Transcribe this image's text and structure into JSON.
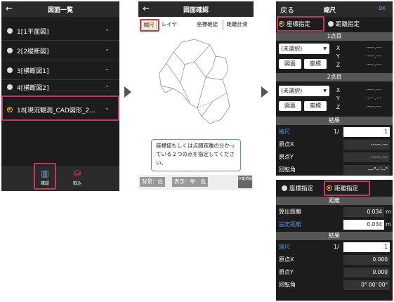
{
  "panel1": {
    "title": "図面一覧",
    "back": "←",
    "items": [
      {
        "label": "1[1平面図]"
      },
      {
        "label": "2[2縦断図]"
      },
      {
        "label": "3[横断図1]"
      },
      {
        "label": "4[横断図2]"
      },
      {
        "label": "18[現況観測_CAD図形_2..."
      }
    ],
    "chevron": "⌄",
    "bottom": [
      {
        "icon": "▥",
        "label": "確認"
      },
      {
        "icon": "⛁",
        "label": "取込"
      }
    ]
  },
  "panel2": {
    "title": "図面確認",
    "back": "←",
    "tabs": [
      "縮尺",
      "レイヤ",
      "座標確認",
      "距離計測"
    ],
    "message": "座標値もしくは点間距離の分かっている２つの点を指定してください。",
    "footer": {
      "bg": "背景：白",
      "display": "表示：単　色",
      "work": "作業領域"
    }
  },
  "panel3": {
    "back": "戻る",
    "title": "縮尺",
    "ok": "OK",
    "radio": [
      "座標指定",
      "距離指定"
    ],
    "point1": "1点目",
    "point2": "2点目",
    "unselected": "(未選択)",
    "btn_drawing": "図面",
    "btn_coord": "座標",
    "axes": [
      "X",
      "Y",
      "Z"
    ],
    "dash": "-----.---",
    "result": "結果",
    "scale_label": "縮尺",
    "scale_prefix": "1/",
    "scale_value": "1",
    "origin_x": "原点X",
    "origin_y": "原点Y",
    "rotation": "回転角",
    "rotation_value": "---°--'--\""
  },
  "panel4": {
    "radio": [
      "座標指定",
      "距離指定"
    ],
    "distance": "距離",
    "calc_distance": "算出距離",
    "calc_value": "0.034",
    "set_distance": "設定距離",
    "set_value": "0.034",
    "unit": "m",
    "result": "結果",
    "scale_label": "縮尺",
    "scale_prefix": "1/",
    "scale_value": "1",
    "origin_x": "原点X",
    "origin_x_value": "0.000",
    "origin_y": "原点Y",
    "origin_y_value": "0.000",
    "rotation": "回転角",
    "rotation_value": "0° 00' 00\""
  }
}
